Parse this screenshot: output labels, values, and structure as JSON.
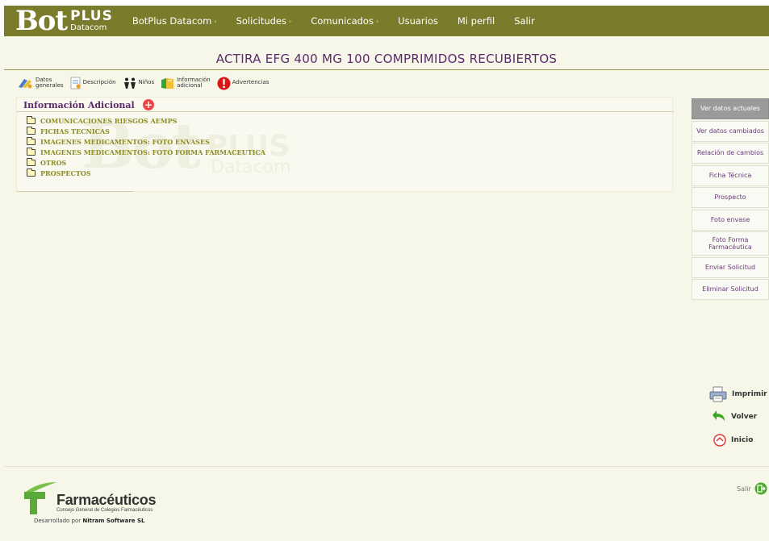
{
  "nav": {
    "logo_main": "Bot",
    "logo_plus": "PLUS",
    "logo_sub": "Datacom",
    "items": [
      {
        "label": "BotPlus Datacom",
        "dropdown": true
      },
      {
        "label": "Solicitudes",
        "dropdown": true
      },
      {
        "label": "Comunicados",
        "dropdown": true
      },
      {
        "label": "Usuarios",
        "dropdown": false
      },
      {
        "label": "Mi perfil",
        "dropdown": false
      },
      {
        "label": "Salir",
        "dropdown": false
      }
    ],
    "caret": "›",
    "background": "#7b7b2c"
  },
  "title": "ACTIRA EFG 400 MG 100 COMPRIMIDOS RECUBIERTOS",
  "tabs": [
    {
      "label_line1": "Datos",
      "label_line2": "generales",
      "icon": "datos-generales-icon"
    },
    {
      "label_line1": "Descripción",
      "label_line2": "",
      "icon": "descripcion-icon"
    },
    {
      "label_line1": "Niños",
      "label_line2": "",
      "icon": "ninos-icon"
    },
    {
      "label_line1": "Información",
      "label_line2": "adicional",
      "icon": "informacion-adicional-icon"
    },
    {
      "label_line1": "Advertencias",
      "label_line2": "",
      "icon": "advertencias-icon"
    }
  ],
  "panel": {
    "title": "Información Adicional",
    "add_symbol": "+",
    "folders": [
      "COMUNICACIONES RIESGOS AEMPS",
      "FICHAS TECNICAS",
      "IMAGENES MEDICAMENTOS: FOTO ENVASES",
      "IMAGENES MEDICAMENTOS: FOTO FORMA FARMACEUTICA",
      "OTROS",
      "PROSPECTOS"
    ]
  },
  "side_buttons": [
    {
      "label": "Ver datos actuales",
      "active": true
    },
    {
      "label": "Ver datos cambiados",
      "active": false
    },
    {
      "label": "Relación de cambios",
      "active": false
    },
    {
      "label": "Ficha Técnica",
      "active": false
    },
    {
      "label": "Prospecto",
      "active": false
    },
    {
      "label": "Foto envase",
      "active": false
    },
    {
      "label": "Foto Forma\nFarmacéutica",
      "active": false
    },
    {
      "label": "Enviar Solicitud",
      "active": false
    },
    {
      "label": "Eliminar Solicitud",
      "active": false
    }
  ],
  "actions": {
    "print": "Imprimir",
    "back": "Volver",
    "home": "Inicio"
  },
  "footer": {
    "org_name": "Farmacéuticos",
    "org_sub": "Consejo General de Colegios Farmacéuticos",
    "dev_prefix": "Desarrollado por",
    "dev_name": "Nitram Software SL",
    "salir": "Salir"
  },
  "colors": {
    "accent_olive": "#7b7b2c",
    "title_purple": "#5a2a6a",
    "folder_text": "#8c8c22",
    "page_bg": "#f6f6e9"
  }
}
